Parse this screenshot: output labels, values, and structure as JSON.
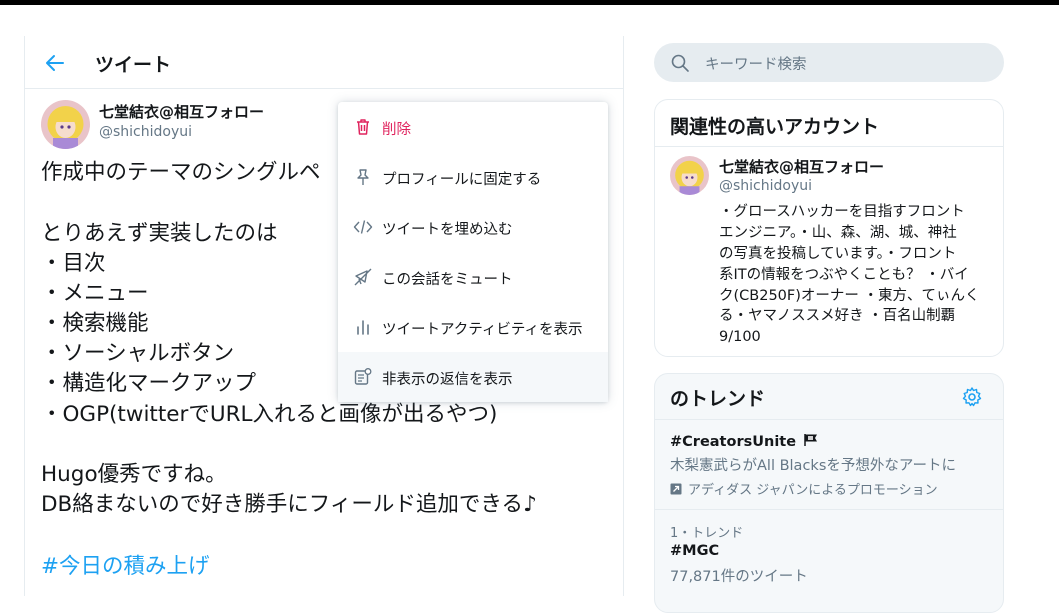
{
  "header": {
    "title": "ツイート"
  },
  "tweet": {
    "author_name": "七堂結衣@相互フォロー",
    "author_handle": "@shichidoyui",
    "lines": [
      "作成中のテーマのシングルペ",
      "",
      "とりあえず実装したのは",
      "・目次",
      "・メニュー",
      "・検索機能",
      "・ソーシャルボタン",
      "・構造化マークアップ",
      "・OGP(twitterでURL入れると画像が出るやつ)",
      "",
      "Hugo優秀ですね。",
      "DB絡まないので好き勝手にフィールド追加できる♪",
      "",
      "#今日の積み上げ"
    ]
  },
  "menu": {
    "items": [
      {
        "label": "削除",
        "icon": "trash-icon"
      },
      {
        "label": "プロフィールに固定する",
        "icon": "pin-icon"
      },
      {
        "label": "ツイートを埋め込む",
        "icon": "code-icon"
      },
      {
        "label": "この会話をミュート",
        "icon": "mute-icon"
      },
      {
        "label": "ツイートアクティビティを表示",
        "icon": "bar-chart-icon"
      },
      {
        "label": "非表示の返信を表示",
        "icon": "hidden-replies-icon"
      }
    ]
  },
  "search": {
    "placeholder": "キーワード検索"
  },
  "related": {
    "title": "関連性の高いアカウント",
    "name": "七堂結衣@相互フォロー",
    "handle": "@shichidoyui",
    "bio_lines": [
      "・グロースハッカーを目指すフロント",
      "エンジニア。・山、森、湖、城、神社",
      "の写真を投稿しています。・フロント",
      "系ITの情報をつぶやくことも？ ・バイ",
      "ク(CB250F)オーナー ・東方、てぃんく",
      "る・ヤマノススメ好き ・百名山制覇",
      "9/100"
    ]
  },
  "trends": {
    "title": "のトレンド",
    "items": [
      {
        "tag": "#CreatorsUnite",
        "desc": "木梨憲武らがAll Blacksを予想外なアートに",
        "promo": "アディダス ジャパンによるプロモーション"
      },
      {
        "meta": "1・トレンド",
        "tag": "#MGC",
        "desc": "77,871件のツイート"
      }
    ]
  },
  "colors": {
    "accent": "#1da1f2",
    "danger": "#e0245e",
    "muted": "#657786",
    "border": "#e6ecf0"
  }
}
